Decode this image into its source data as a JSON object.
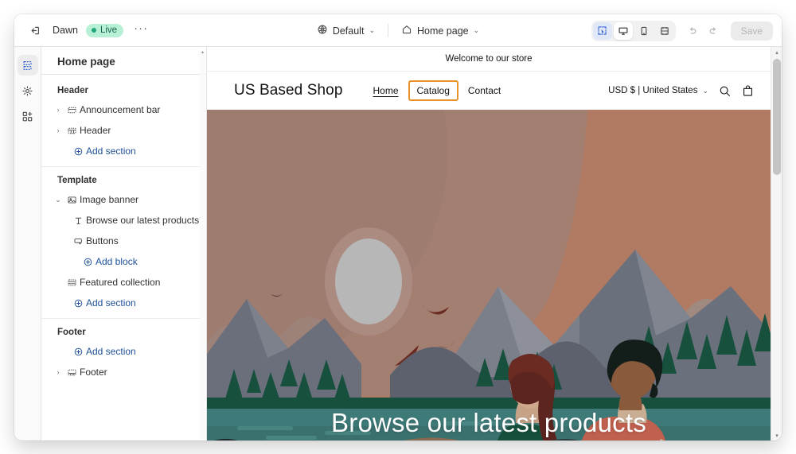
{
  "topbar": {
    "exit_icon": "exit-arrow-icon",
    "theme_name": "Dawn",
    "status_badge": "Live",
    "more_menu": "···",
    "locale_selector": {
      "icon": "globe-icon",
      "label": "Default",
      "chevron": "⌄"
    },
    "page_selector": {
      "icon": "home-icon",
      "label": "Home page",
      "chevron": "⌄"
    },
    "view_modes": [
      {
        "name": "inspector-tool",
        "icon": "dashed-select-icon",
        "state": "active-blue"
      },
      {
        "name": "desktop-view",
        "icon": "desktop-monitor-icon",
        "state": "active-white"
      },
      {
        "name": "mobile-view",
        "icon": "mobile-phone-icon",
        "state": "inactive"
      },
      {
        "name": "fullwidth-view",
        "icon": "fullwidth-icon",
        "state": "inactive"
      }
    ],
    "undo": "undo-arrow-icon",
    "redo": "redo-arrow-icon",
    "save_label": "Save"
  },
  "rail": [
    {
      "name": "sections-panel",
      "icon": "sections-icon",
      "active": true
    },
    {
      "name": "theme-settings",
      "icon": "gear-icon",
      "active": false
    },
    {
      "name": "apps-panel",
      "icon": "apps-blocks-icon",
      "active": false
    }
  ],
  "sidebar": {
    "title": "Home page",
    "groups": [
      {
        "heading": "Header",
        "rows": [
          {
            "chevron": "›",
            "icon": "announcement-bar-icon",
            "label": "Announcement bar",
            "kind": "section"
          },
          {
            "chevron": "›",
            "icon": "header-section-icon",
            "label": "Header",
            "kind": "section"
          },
          {
            "chevron": "",
            "icon": "plus-circle-icon",
            "label": "Add section",
            "kind": "add"
          }
        ]
      },
      {
        "heading": "Template",
        "rows": [
          {
            "chevron": "⌄",
            "icon": "image-banner-icon",
            "label": "Image banner",
            "kind": "section"
          },
          {
            "chevron": "",
            "icon": "text-block-icon",
            "label": "Browse our latest products",
            "kind": "block"
          },
          {
            "chevron": "",
            "icon": "button-block-icon",
            "label": "Buttons",
            "kind": "block"
          },
          {
            "chevron": "",
            "icon": "plus-circle-icon",
            "label": "Add block",
            "kind": "add-block"
          },
          {
            "chevron": "",
            "icon": "collection-icon",
            "label": "Featured collection",
            "kind": "section-nochev"
          },
          {
            "chevron": "",
            "icon": "plus-circle-icon",
            "label": "Add section",
            "kind": "add"
          }
        ]
      },
      {
        "heading": "Footer",
        "rows": [
          {
            "chevron": "",
            "icon": "plus-circle-icon",
            "label": "Add section",
            "kind": "add"
          },
          {
            "chevron": "›",
            "icon": "footer-section-icon",
            "label": "Footer",
            "kind": "section"
          }
        ]
      }
    ],
    "scrollbar_arrow": "▴"
  },
  "preview": {
    "announcement": "Welcome to our store",
    "shop_name": "US Based Shop",
    "nav": [
      {
        "label": "Home",
        "state": "current"
      },
      {
        "label": "Catalog",
        "state": "highlighted"
      },
      {
        "label": "Contact",
        "state": "normal"
      }
    ],
    "locale_picker": {
      "label": "USD $ | United States",
      "chevron": "⌄"
    },
    "search_icon": "magnifier-icon",
    "cart_icon": "shopping-bag-icon",
    "banner_heading": "Browse our latest products",
    "scroll_up": "▴",
    "scroll_down": "▾"
  },
  "colors": {
    "highlight_orange": "#e8922a",
    "accent_blue": "#2c5ecf",
    "link_blue": "#1f5199",
    "live_green_bg": "#b8f0d6",
    "live_green_dot": "#20a87b",
    "sky_top": "#9c7b6c",
    "sky_mid": "#a8847a",
    "sun": "#b4b4b4",
    "mountain_slate": "#6b707d",
    "forest_green": "#17513d",
    "lake_teal": "#3d7a78",
    "shirt_red": "#c0604f",
    "shirt_green": "#16503c"
  }
}
